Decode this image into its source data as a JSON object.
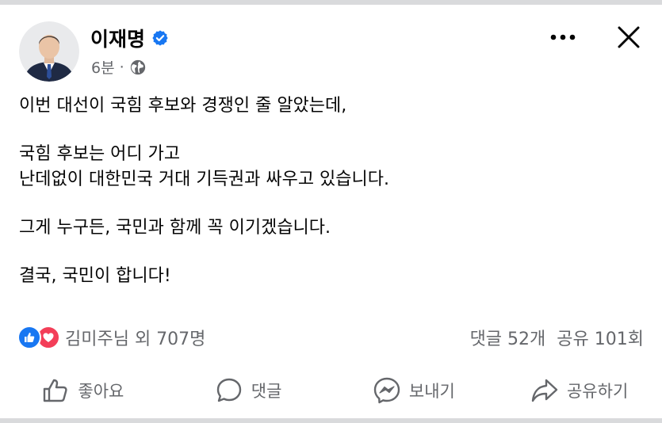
{
  "post": {
    "author_name": "이재명",
    "timestamp": "6분",
    "separator": "·",
    "audience_icon": "globe-icon",
    "verified_icon": "verified-badge-icon",
    "body": {
      "paragraph1": "이번 대선이 국힘 후보와 경쟁인 줄 알았는데,",
      "paragraph2": "국힘 후보는 어디 가고\n난데없이 대한민국 거대 기득권과 싸우고 있습니다.",
      "paragraph3": "그게 누구든, 국민과 함께 꼭 이기겠습니다.",
      "paragraph4": "결국, 국민이 합니다!"
    }
  },
  "stats": {
    "reactions_text": "김미주님 외 707명",
    "comments": "댓글 52개",
    "shares": "공유 101회"
  },
  "actions": {
    "like": "좋아요",
    "comment": "댓글",
    "send": "보내기",
    "share": "공유하기"
  },
  "colors": {
    "accent": "#1877f2",
    "love": "#f33e58",
    "secondary_text": "#65676b",
    "primary_text": "#050505"
  }
}
